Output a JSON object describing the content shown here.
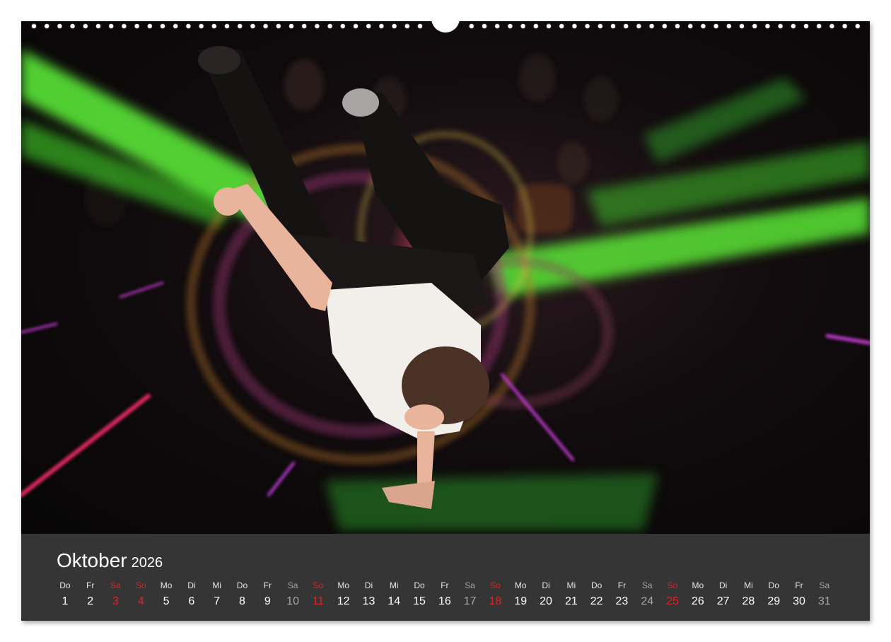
{
  "calendar": {
    "month": "Oktober",
    "year": "2026",
    "days": [
      {
        "abbr": "Do",
        "num": "1",
        "kind": "weekday"
      },
      {
        "abbr": "Fr",
        "num": "2",
        "kind": "weekday"
      },
      {
        "abbr": "Sa",
        "num": "3",
        "kind": "holiday"
      },
      {
        "abbr": "So",
        "num": "4",
        "kind": "holiday"
      },
      {
        "abbr": "Mo",
        "num": "5",
        "kind": "weekday"
      },
      {
        "abbr": "Di",
        "num": "6",
        "kind": "weekday"
      },
      {
        "abbr": "Mi",
        "num": "7",
        "kind": "weekday"
      },
      {
        "abbr": "Do",
        "num": "8",
        "kind": "weekday"
      },
      {
        "abbr": "Fr",
        "num": "9",
        "kind": "weekday"
      },
      {
        "abbr": "Sa",
        "num": "10",
        "kind": "saturday"
      },
      {
        "abbr": "So",
        "num": "11",
        "kind": "holiday"
      },
      {
        "abbr": "Mo",
        "num": "12",
        "kind": "weekday"
      },
      {
        "abbr": "Di",
        "num": "13",
        "kind": "weekday"
      },
      {
        "abbr": "Mi",
        "num": "14",
        "kind": "weekday"
      },
      {
        "abbr": "Do",
        "num": "15",
        "kind": "weekday"
      },
      {
        "abbr": "Fr",
        "num": "16",
        "kind": "weekday"
      },
      {
        "abbr": "Sa",
        "num": "17",
        "kind": "saturday"
      },
      {
        "abbr": "So",
        "num": "18",
        "kind": "holiday"
      },
      {
        "abbr": "Mo",
        "num": "19",
        "kind": "weekday"
      },
      {
        "abbr": "Di",
        "num": "20",
        "kind": "weekday"
      },
      {
        "abbr": "Mi",
        "num": "21",
        "kind": "weekday"
      },
      {
        "abbr": "Do",
        "num": "22",
        "kind": "weekday"
      },
      {
        "abbr": "Fr",
        "num": "23",
        "kind": "weekday"
      },
      {
        "abbr": "Sa",
        "num": "24",
        "kind": "saturday"
      },
      {
        "abbr": "So",
        "num": "25",
        "kind": "holiday"
      },
      {
        "abbr": "Mo",
        "num": "26",
        "kind": "weekday"
      },
      {
        "abbr": "Di",
        "num": "27",
        "kind": "weekday"
      },
      {
        "abbr": "Mi",
        "num": "28",
        "kind": "weekday"
      },
      {
        "abbr": "Do",
        "num": "29",
        "kind": "weekday"
      },
      {
        "abbr": "Fr",
        "num": "30",
        "kind": "weekday"
      },
      {
        "abbr": "Sa",
        "num": "31",
        "kind": "saturday"
      }
    ]
  },
  "photo": {
    "subject": "breakdancer-handstand-icon",
    "colors": {
      "laser_green": "#5ef23a",
      "laser_magenta": "#d12a8c",
      "laser_pink": "#ff3b6b",
      "shirt": "#f2efea",
      "pants": "#151212",
      "skin": "#e8b59c",
      "hair": "#4a3326",
      "calendar_bar": "#353535",
      "sunday_red": "#d8262b",
      "saturday_gray": "#a6a6a6"
    }
  }
}
